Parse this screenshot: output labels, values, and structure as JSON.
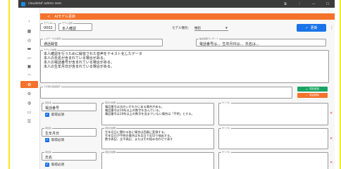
{
  "window": {
    "title": "cloudstaf admin sem",
    "controls": [
      "⧉",
      "⁝",
      "—",
      "☐"
    ]
  },
  "sidebar": {
    "icons": [
      {
        "name": "collapse-icon",
        "glyph": "‹"
      },
      {
        "name": "grid-icon",
        "glyph": "▦"
      },
      {
        "name": "settings-icon",
        "glyph": "◎"
      },
      {
        "name": "chat-icon",
        "glyph": "▬"
      },
      {
        "name": "trend-icon",
        "glyph": "〰"
      },
      {
        "name": "image-icon",
        "glyph": "▣"
      },
      {
        "name": "headset-icon",
        "glyph": "◠"
      },
      {
        "name": "gear-icon",
        "glyph": "✿"
      },
      {
        "name": "org-icon",
        "glyph": "⚙"
      },
      {
        "name": "database-icon",
        "glyph": "◍"
      },
      {
        "name": "monitor-icon",
        "glyph": "▭"
      },
      {
        "name": "list-icon",
        "glyph": "☰"
      }
    ]
  },
  "header": {
    "back": "<",
    "title": "AIモデル更新"
  },
  "form": {
    "model_no": {
      "label": "モデルNo",
      "value": "0002"
    },
    "model_name": {
      "label": "モデル名称",
      "value": "本人確認"
    },
    "model_type": {
      "label": "モデル種別：",
      "value": "抽出"
    },
    "update_button": "更新",
    "input_data_name": {
      "label": "入力データの名称",
      "value": "通話録音"
    },
    "output_guidance": {
      "label": "抽出結果ガイダンス",
      "value": "電話番号は、、生年月日は、、氏名は、、"
    },
    "description": {
      "label": "モデルの説明",
      "lines": [
        "本人確認を行うために録音された音声をテキスト化したデータ",
        "本人の氏名が含まれている場合がある。",
        "本人の電話番号が含まれている場合がある。",
        "本人の生年月日が含まれている場合がある。"
      ]
    },
    "memo": {
      "label": "その他の追加指示",
      "value": ""
    }
  },
  "actions": {
    "add_item": "項目追加",
    "delete_item": "項目削除"
  },
  "items": [
    {
      "name_label": "項目名",
      "name": "電話番号",
      "required_label": "取得必須",
      "desc_label": "項目の説明",
      "desc_lines": [
        "電話番号は次のいずれかにある場合がある。",
        "電話番号は10桁以上の数字を含んでいる。",
        "電話番号は10桁以上の数字を含までいない場合は「不明」とする。"
      ],
      "sample_label": "サンプル",
      "sample": ""
    },
    {
      "name_label": "項目名",
      "name": "生年月日",
      "required_label": "取得必須",
      "desc_label": "項目の説明",
      "desc_lines": [
        "生年月日に関わる各に場合は西暦に変換する。",
        "生年月日が不明の場合は年月日で区切り抽出する。",
        "数字表記、全平表記、またはその組み合わせで表す"
      ],
      "sample_label": "サンプル",
      "sample": ""
    },
    {
      "name_label": "項目名",
      "name": "氏名",
      "required_label": "取得必須",
      "desc_label": "項目の説明",
      "desc_lines": [],
      "sample_label": "サンプル",
      "sample": ""
    }
  ],
  "colors": {
    "accent_orange": "#f4722b",
    "primary_blue": "#1a73e8",
    "add_green": "#19a463",
    "titlebar": "#3b3b3b",
    "frame_stripe": "#f5ea1a"
  }
}
